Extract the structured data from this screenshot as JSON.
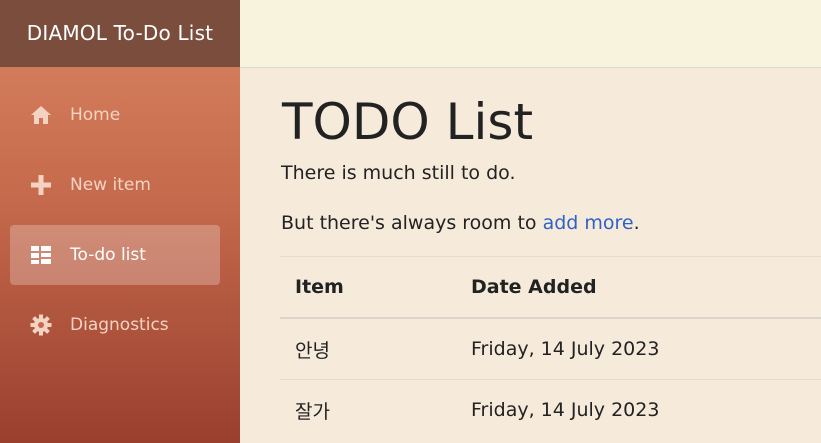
{
  "brand": {
    "title": "DIAMOL To-Do List"
  },
  "sidebar": {
    "items": [
      {
        "label": "Home",
        "icon": "home-icon",
        "active": false
      },
      {
        "label": "New item",
        "icon": "plus-icon",
        "active": false
      },
      {
        "label": "To-do list",
        "icon": "list-icon",
        "active": true
      },
      {
        "label": "Diagnostics",
        "icon": "gear-icon",
        "active": false
      }
    ]
  },
  "main": {
    "title": "TODO List",
    "lead": "There is much still to do.",
    "sub_prefix": "But there's always room to ",
    "sub_link": "add more",
    "sub_suffix": "."
  },
  "table": {
    "headers": [
      "Item",
      "Date Added"
    ],
    "rows": [
      {
        "item": "안녕",
        "date": "Friday, 14 July 2023"
      },
      {
        "item": "잘가",
        "date": "Friday, 14 July 2023"
      }
    ]
  },
  "colors": {
    "sidebar_top": "#d98462",
    "sidebar_bottom": "#9a3f2e",
    "brand_bg": "#7a4d3d",
    "topbar_bg": "#f7f3dc",
    "content_bg": "#f6ebdb",
    "link": "#2f62c7"
  }
}
